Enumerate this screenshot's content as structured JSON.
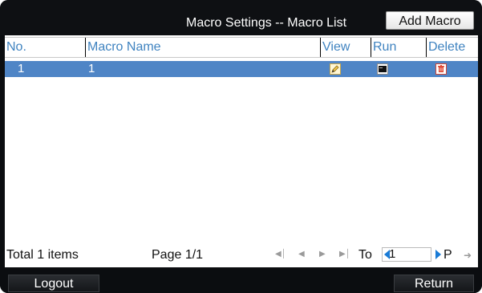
{
  "header": {
    "title": "Macro Settings -- Macro List",
    "add_button_label": "Add Macro"
  },
  "table": {
    "columns": [
      "No.",
      "Macro Name",
      "View",
      "Run",
      "Delete"
    ],
    "rows": [
      {
        "no": "1",
        "name": "1",
        "view_icon": "edit-icon",
        "run_icon": "run-icon",
        "delete_icon": "trash-icon"
      }
    ]
  },
  "footer": {
    "total": "Total 1 items",
    "page": "Page 1/1",
    "goto_label": "To",
    "goto_value": "1",
    "goto_suffix": "P",
    "nav_icons": [
      "first-page-icon",
      "prev-page-icon",
      "next-page-icon",
      "last-page-icon",
      "go-arrow-icon"
    ]
  },
  "bottom": {
    "logout_label": "Logout",
    "return_label": "Return"
  },
  "colors": {
    "selected_row": "#4f85c6",
    "header_text": "#3f83c0",
    "background": "#0b0d10"
  }
}
